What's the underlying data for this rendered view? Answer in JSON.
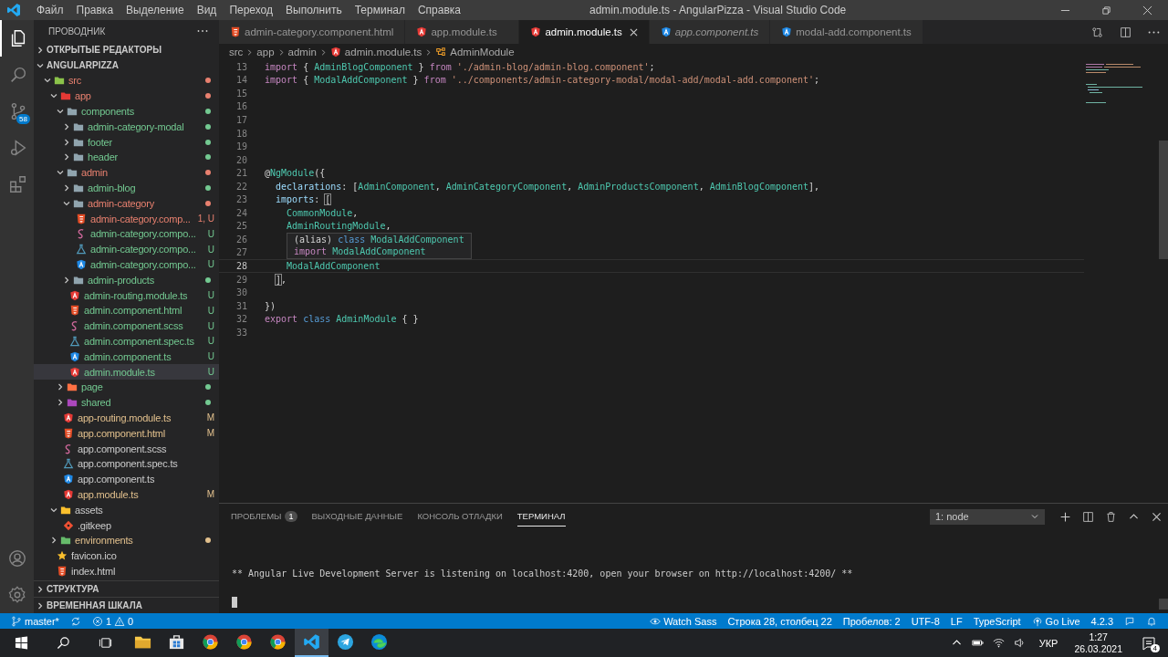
{
  "window": {
    "title": "admin.module.ts - AngularPizza - Visual Studio Code"
  },
  "menu": [
    "Файл",
    "Правка",
    "Выделение",
    "Вид",
    "Переход",
    "Выполнить",
    "Терминал",
    "Справка"
  ],
  "activity_bar": {
    "items": [
      {
        "kind": "files",
        "selected": true
      },
      {
        "kind": "search",
        "selected": false
      },
      {
        "kind": "source-control",
        "selected": false,
        "badge": "58"
      },
      {
        "kind": "run",
        "selected": false
      },
      {
        "kind": "extensions",
        "selected": false
      }
    ],
    "bottom": [
      {
        "kind": "account"
      },
      {
        "kind": "settings"
      }
    ]
  },
  "explorer": {
    "title": "ПРОВОДНИК",
    "open_editors": {
      "label": "ОТКРЫТЫЕ РЕДАКТОРЫ",
      "expanded": false
    },
    "folder": {
      "label": "ANGULARPIZZA",
      "expanded": true
    },
    "tree": [
      {
        "name": "src",
        "kind": "folder-src",
        "color": "#e8806f",
        "expanded": true,
        "selected": false,
        "children": [
          {
            "name": "app",
            "kind": "folder-app",
            "color": "#e8806f",
            "expanded": true,
            "selected": false,
            "children": [
              {
                "name": "components",
                "kind": "folder",
                "color": "#73c991",
                "expanded": true,
                "selected": false,
                "children": [
                  {
                    "name": "admin-category-modal",
                    "kind": "folder",
                    "color": "#73c991",
                    "expanded": false,
                    "selected": false
                  },
                  {
                    "name": "footer",
                    "kind": "folder",
                    "color": "#73c991",
                    "expanded": false,
                    "selected": false
                  },
                  {
                    "name": "header",
                    "kind": "folder",
                    "color": "#73c991",
                    "expanded": false,
                    "selected": false
                  }
                ]
              },
              {
                "name": "admin",
                "kind": "folder",
                "color": "#e8806f",
                "expanded": true,
                "selected": false,
                "children": [
                  {
                    "name": "admin-blog",
                    "kind": "folder",
                    "color": "#73c991",
                    "expanded": false,
                    "selected": false
                  },
                  {
                    "name": "admin-category",
                    "kind": "folder",
                    "color": "#e8806f",
                    "expanded": true,
                    "selected": false,
                    "children": [
                      {
                        "name": "admin-category.comp...",
                        "kind": "html",
                        "color": "#e8806f",
                        "badge": "1, U",
                        "selected": false
                      },
                      {
                        "name": "admin-category.compo...",
                        "kind": "scss",
                        "color": "#73c991",
                        "badge": "U",
                        "selected": false
                      },
                      {
                        "name": "admin-category.compo...",
                        "kind": "spec",
                        "color": "#73c991",
                        "badge": "U",
                        "selected": false
                      },
                      {
                        "name": "admin-category.compo...",
                        "kind": "component",
                        "color": "#73c991",
                        "badge": "U",
                        "selected": false
                      }
                    ]
                  },
                  {
                    "name": "admin-products",
                    "kind": "folder",
                    "color": "#73c991",
                    "expanded": false,
                    "selected": false
                  },
                  {
                    "name": "admin-routing.module.ts",
                    "kind": "module",
                    "color": "#73c991",
                    "badge": "U",
                    "selected": false
                  },
                  {
                    "name": "admin.component.html",
                    "kind": "html",
                    "color": "#73c991",
                    "badge": "U",
                    "selected": false
                  },
                  {
                    "name": "admin.component.scss",
                    "kind": "scss",
                    "color": "#73c991",
                    "badge": "U",
                    "selected": false
                  },
                  {
                    "name": "admin.component.spec.ts",
                    "kind": "spec",
                    "color": "#73c991",
                    "badge": "U",
                    "selected": false
                  },
                  {
                    "name": "admin.component.ts",
                    "kind": "component",
                    "color": "#73c991",
                    "badge": "U",
                    "selected": false
                  },
                  {
                    "name": "admin.module.ts",
                    "kind": "module",
                    "color": "#73c991",
                    "badge": "U",
                    "selected": true
                  }
                ]
              },
              {
                "name": "page",
                "kind": "folder-page",
                "color": "#73c991",
                "expanded": false,
                "selected": false
              },
              {
                "name": "shared",
                "kind": "folder-shared",
                "color": "#73c991",
                "expanded": false,
                "selected": false
              },
              {
                "name": "app-routing.module.ts",
                "kind": "module",
                "color": "#e2c08d",
                "badge": "M",
                "selected": false
              },
              {
                "name": "app.component.html",
                "kind": "html",
                "color": "#e2c08d",
                "badge": "M",
                "selected": false
              },
              {
                "name": "app.component.scss",
                "kind": "scss",
                "selected": false
              },
              {
                "name": "app.component.spec.ts",
                "kind": "spec",
                "selected": false
              },
              {
                "name": "app.component.ts",
                "kind": "component",
                "selected": false
              },
              {
                "name": "app.module.ts",
                "kind": "module",
                "color": "#e2c08d",
                "badge": "M",
                "selected": false
              }
            ]
          },
          {
            "name": "assets",
            "kind": "folder-assets",
            "expanded": true,
            "selected": false,
            "children": [
              {
                "name": ".gitkeep",
                "kind": "git",
                "selected": false
              }
            ]
          },
          {
            "name": "environments",
            "kind": "folder-env",
            "color": "#e2c08d",
            "expanded": false,
            "selected": false
          },
          {
            "name": "favicon.ico",
            "kind": "favicon",
            "selected": false
          },
          {
            "name": "index.html",
            "kind": "html",
            "selected": false
          }
        ]
      }
    ],
    "bottom_sections": [
      {
        "label": "СТРУКТУРА",
        "expanded": false
      },
      {
        "label": "ВРЕМЕННАЯ ШКАЛА",
        "expanded": false
      }
    ]
  },
  "tabs": [
    {
      "label": "admin-category.component.html",
      "kind": "html",
      "selected": false,
      "preview": false
    },
    {
      "label": "app.module.ts",
      "kind": "module",
      "selected": false,
      "preview": false
    },
    {
      "label": "admin.module.ts",
      "kind": "module",
      "selected": true,
      "preview": false
    },
    {
      "label": "app.component.ts",
      "kind": "component",
      "selected": false,
      "preview": true
    },
    {
      "label": "modal-add.component.ts",
      "kind": "component",
      "selected": false,
      "preview": false
    }
  ],
  "breadcrumbs": [
    {
      "label": "src",
      "kind": "folder"
    },
    {
      "label": "app",
      "kind": "folder"
    },
    {
      "label": "admin",
      "kind": "folder"
    },
    {
      "label": "admin.module.ts",
      "kind": "module"
    },
    {
      "label": "AdminModule",
      "kind": "class"
    }
  ],
  "editor": {
    "lines": [
      {
        "number": "13",
        "current": false,
        "tokens": [
          {
            "text": "import",
            "kind": "keyword"
          },
          {
            "text": " { ",
            "kind": "punct"
          },
          {
            "text": "AdminBlogComponent",
            "kind": "name"
          },
          {
            "text": " } ",
            "kind": "punct"
          },
          {
            "text": "from ",
            "kind": "keyword"
          },
          {
            "text": "'./admin-blog/admin-blog.component'",
            "kind": "string"
          },
          {
            "text": ";",
            "kind": "punct"
          }
        ]
      },
      {
        "number": "14",
        "current": false,
        "tokens": [
          {
            "text": "import",
            "kind": "keyword"
          },
          {
            "text": " { ",
            "kind": "punct"
          },
          {
            "text": "ModalAddComponent",
            "kind": "name"
          },
          {
            "text": " } ",
            "kind": "punct"
          },
          {
            "text": "from ",
            "kind": "keyword"
          },
          {
            "text": "'../components/admin-category-modal/modal-add/modal-add.component'",
            "kind": "string"
          },
          {
            "text": ";",
            "kind": "punct"
          }
        ]
      },
      {
        "number": "15",
        "current": false
      },
      {
        "number": "16",
        "current": false
      },
      {
        "number": "17",
        "current": false
      },
      {
        "number": "18",
        "current": false
      },
      {
        "number": "19",
        "current": false
      },
      {
        "number": "20",
        "current": false
      },
      {
        "number": "21",
        "current": false,
        "tokens": [
          {
            "text": "@",
            "kind": "punct"
          },
          {
            "text": "NgModule",
            "kind": "name"
          },
          {
            "text": "({",
            "kind": "punct"
          }
        ]
      },
      {
        "number": "22",
        "current": false,
        "tokens": [
          {
            "text": "  declarations",
            "kind": "property"
          },
          {
            "text": ": [",
            "kind": "punct"
          },
          {
            "text": "AdminComponent",
            "kind": "name"
          },
          {
            "text": ", ",
            "kind": "punct"
          },
          {
            "text": "AdminCategoryComponent",
            "kind": "name"
          },
          {
            "text": ", ",
            "kind": "punct"
          },
          {
            "text": "AdminProductsComponent",
            "kind": "name"
          },
          {
            "text": ", ",
            "kind": "punct"
          },
          {
            "text": "AdminBlogComponent",
            "kind": "name"
          },
          {
            "text": "],",
            "kind": "punct"
          }
        ]
      },
      {
        "number": "23",
        "current": false,
        "tokens": [
          {
            "text": "  imports",
            "kind": "property"
          },
          {
            "text": ": ",
            "kind": "punct"
          },
          {
            "text": "[",
            "kind": "bracket-match"
          }
        ]
      },
      {
        "number": "24",
        "current": false,
        "tokens": [
          {
            "text": "    CommonModule",
            "kind": "name"
          },
          {
            "text": ",",
            "kind": "punct"
          }
        ]
      },
      {
        "number": "25",
        "current": false,
        "tokens": [
          {
            "text": "    AdminRoutingModule",
            "kind": "name"
          },
          {
            "text": ",",
            "kind": "punct"
          }
        ],
        "hover": {
          "lines": [
            [
              {
                "text": "(alias) ",
                "kind": "punct"
              },
              {
                "text": "class ",
                "kind": "storage"
              },
              {
                "text": "ModalAddComponent",
                "kind": "name"
              }
            ],
            [
              {
                "text": "import ",
                "kind": "keyword"
              },
              {
                "text": "ModalAddComponent",
                "kind": "name"
              }
            ]
          ]
        }
      },
      {
        "number": "26",
        "current": false
      },
      {
        "number": "27",
        "current": false
      },
      {
        "number": "28",
        "current": true,
        "tokens": [
          {
            "text": "    ModalAddComponent",
            "kind": "name"
          }
        ]
      },
      {
        "number": "29",
        "current": false,
        "tokens": [
          {
            "text": "  ]",
            "kind": "bracket-match"
          },
          {
            "text": ",",
            "kind": "punct"
          }
        ]
      },
      {
        "number": "30",
        "current": false
      },
      {
        "number": "31",
        "current": false,
        "tokens": [
          {
            "text": "})",
            "kind": "punct"
          }
        ]
      },
      {
        "number": "32",
        "current": false,
        "tokens": [
          {
            "text": "export ",
            "kind": "keyword"
          },
          {
            "text": "class ",
            "kind": "storage"
          },
          {
            "text": "AdminModule",
            "kind": "name"
          },
          {
            "text": " { }",
            "kind": "punct"
          }
        ]
      },
      {
        "number": "33",
        "current": false
      }
    ]
  },
  "panel": {
    "tabs": [
      {
        "label": "ПРОБЛЕМЫ",
        "badge": "1",
        "selected": false
      },
      {
        "label": "ВЫХОДНЫЕ ДАННЫЕ",
        "selected": false
      },
      {
        "label": "КОНСОЛЬ ОТЛАДКИ",
        "selected": false
      },
      {
        "label": "ТЕРМИНАЛ",
        "selected": true
      }
    ],
    "terminal_select": "1: node",
    "terminal_lines": [
      "** Angular Live Development Server is listening on localhost:4200, open your browser on http://localhost:4200/ **"
    ]
  },
  "status_bar": {
    "left": [
      {
        "kind": "branch",
        "label": "master*"
      },
      {
        "kind": "sync"
      },
      {
        "kind": "problems",
        "errors": "1",
        "warnings": "0"
      }
    ],
    "right": [
      {
        "kind": "eye",
        "label": "Watch Sass"
      },
      {
        "kind": "text",
        "label": "Строка 28, столбец 22"
      },
      {
        "kind": "text",
        "label": "Пробелов: 2"
      },
      {
        "kind": "text",
        "label": "UTF-8"
      },
      {
        "kind": "text",
        "label": "LF"
      },
      {
        "kind": "text",
        "label": "TypeScript"
      },
      {
        "kind": "broadcast",
        "label": "Go Live"
      },
      {
        "kind": "text",
        "label": "4.2.3"
      },
      {
        "kind": "feedback"
      },
      {
        "kind": "bell"
      }
    ]
  },
  "taskbar": {
    "apps": [
      {
        "kind": "folder",
        "active": false
      },
      {
        "kind": "store",
        "active": false
      },
      {
        "kind": "browser",
        "active": false
      },
      {
        "kind": "browser",
        "active": false
      },
      {
        "kind": "browser",
        "active": false
      },
      {
        "kind": "code",
        "active": true
      },
      {
        "kind": "messenger",
        "active": false
      },
      {
        "kind": "edge",
        "active": false
      }
    ],
    "language": "УКР",
    "time": "1:27",
    "date": "26.03.2021",
    "notifications": "4"
  }
}
